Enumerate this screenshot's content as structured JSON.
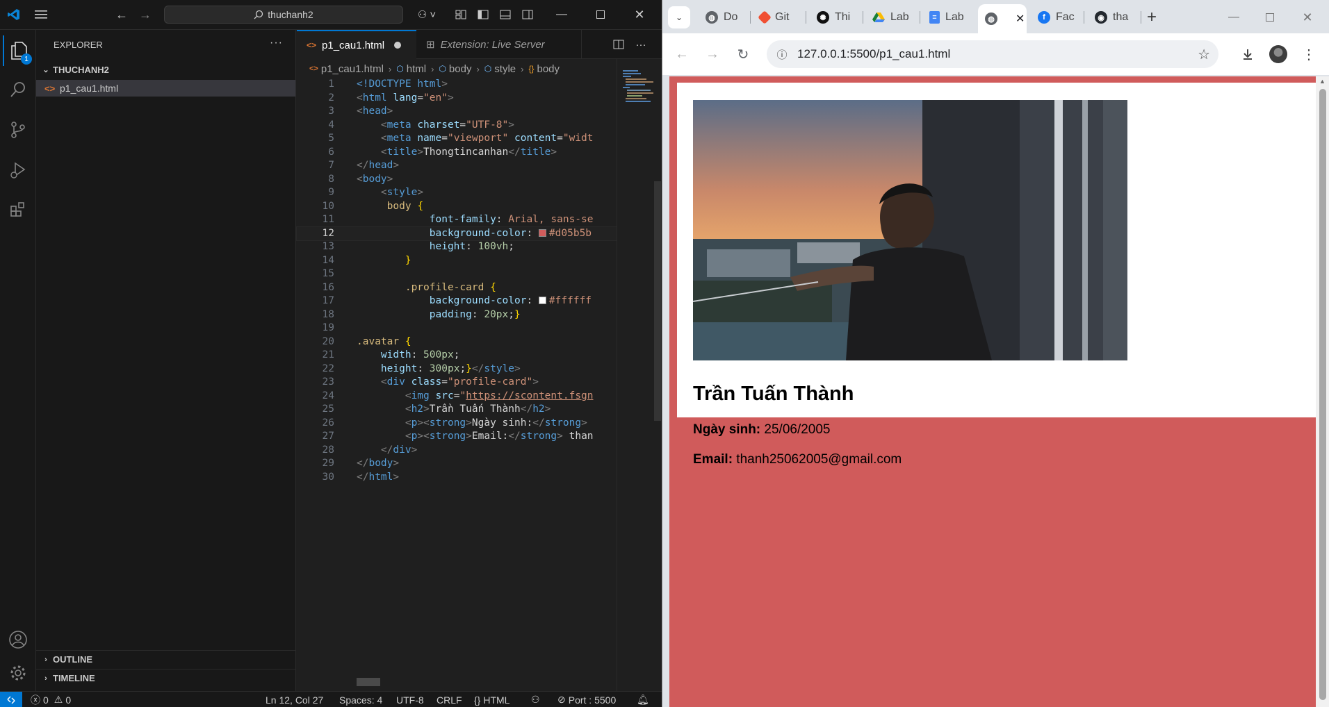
{
  "vscode": {
    "search_text": "thuchanh2",
    "explorer_label": "EXPLORER",
    "folder_name": "THUCHANH2",
    "file_name": "p1_cau1.html",
    "outline_label": "OUTLINE",
    "timeline_label": "TIMELINE",
    "badge_count": "1",
    "tabs": [
      {
        "label": "p1_cau1.html"
      },
      {
        "label": "Extension: Live Server"
      }
    ],
    "breadcrumb": [
      "p1_cau1.html",
      "html",
      "body",
      "style",
      "body"
    ],
    "line_numbers": [
      "1",
      "2",
      "3",
      "4",
      "5",
      "6",
      "7",
      "8",
      "9",
      "10",
      "11",
      "12",
      "13",
      "14",
      "15",
      "16",
      "17",
      "18",
      "19",
      "20",
      "21",
      "22",
      "23",
      "24",
      "25",
      "26",
      "27",
      "28",
      "29",
      "30"
    ],
    "code": {
      "l1_tag": "<!DOCTYPE",
      "l1_kw": "html",
      "l2": "lang",
      "l2v": "\"en\"",
      "l4": "charset",
      "l4v": "\"UTF-8\"",
      "l5a": "name",
      "l5av": "\"viewport\"",
      "l5b": "content",
      "l5bv": "\"widt",
      "l6": "Thongtincanhan",
      "l10": "body",
      "l11p": "font-family",
      "l11v": "Arial, sans-se",
      "l12p": "background-color",
      "l12v": "#d05b5b",
      "l13p": "height",
      "l13v": "100vh",
      "l16": ".profile-card",
      "l17p": "background-color",
      "l17v": "#ffffff",
      "l18p": "padding",
      "l18v": "20px",
      "l20": ".avatar",
      "l21p": "width",
      "l21v": "500px",
      "l22p": "height",
      "l22v": "300px",
      "l23a": "class",
      "l23v": "\"profile-card\"",
      "l24a": "src",
      "l24v": "https://scontent.fsgn",
      "l25": "Trần Tuấn Thành",
      "l26": "Ngày sinh:",
      "l27": "Email:",
      "l27t": " than"
    },
    "status": {
      "errors": "0",
      "warnings": "0",
      "position": "Ln 12, Col 27",
      "spaces": "Spaces: 4",
      "encoding": "UTF-8",
      "eol": "CRLF",
      "language": "HTML",
      "port": "Port : 5500"
    }
  },
  "chrome": {
    "tabs": [
      {
        "label": "Do",
        "icon": "globe-icon"
      },
      {
        "label": "Git",
        "icon": "git-icon"
      },
      {
        "label": "Thi",
        "icon": "openai-icon"
      },
      {
        "label": "Lab",
        "icon": "drive-icon"
      },
      {
        "label": "Lab",
        "icon": "docs-icon"
      },
      {
        "label": "",
        "icon": "globe-icon"
      },
      {
        "label": "Fac",
        "icon": "facebook-icon"
      },
      {
        "label": "tha",
        "icon": "github-icon"
      }
    ],
    "url": "127.0.0.1:5500/p1_cau1.html",
    "page": {
      "name": "Trần Tuấn Thành",
      "dob_label": "Ngày sinh:",
      "dob_value": " 25/06/2005",
      "email_label": "Email:",
      "email_value": " thanh25062005@gmail.com",
      "bg_color": "#d05b5b"
    }
  }
}
